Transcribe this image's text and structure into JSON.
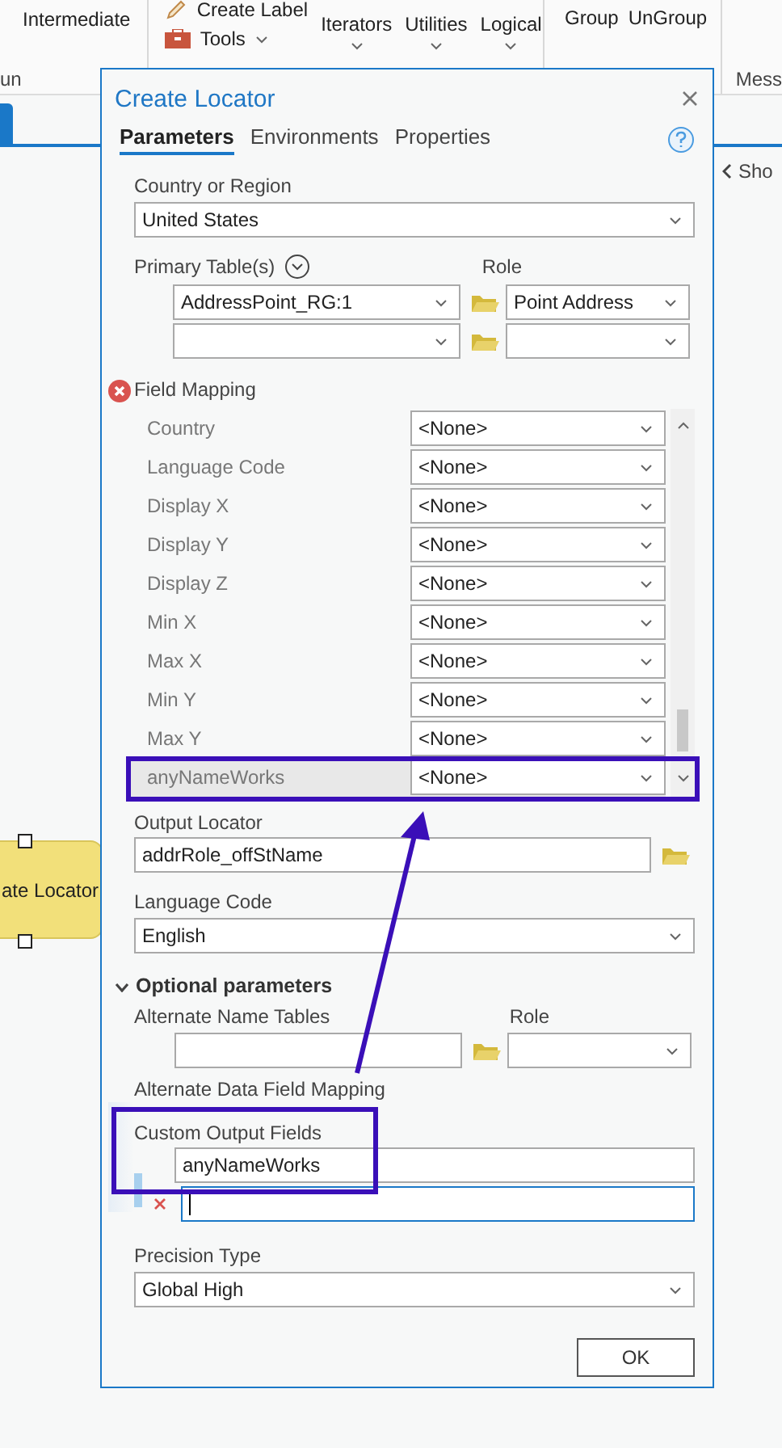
{
  "ribbon": {
    "group_labels": [
      "un",
      "Mess"
    ],
    "intermediate": "Intermediate",
    "create_label": "Create Label",
    "tools": "Tools",
    "menus": [
      "Iterators",
      "Utilities",
      "Logical"
    ],
    "grouping": [
      "Group",
      "UnGroup"
    ]
  },
  "canvas": {
    "node_label": "ate Locator",
    "side_panel": "Sho"
  },
  "dialog": {
    "title": "Create Locator",
    "tabs": [
      {
        "label": "Parameters",
        "selected": true
      },
      {
        "label": "Environments",
        "selected": false
      },
      {
        "label": "Properties",
        "selected": false
      }
    ],
    "country": {
      "label": "Country or Region",
      "value": "United States"
    },
    "primary_tables": {
      "label": "Primary Table(s)",
      "role_label": "Role",
      "rows": [
        {
          "table": "AddressPoint_RG:1",
          "role": "Point Address"
        },
        {}
      ]
    },
    "field_mapping": {
      "label": "Field Mapping",
      "rows": [
        {
          "label": "Country",
          "value": "<None>",
          "selected": false
        },
        {
          "label": "Language Code",
          "value": "<None>",
          "selected": false
        },
        {
          "label": "Display X",
          "value": "<None>",
          "selected": false
        },
        {
          "label": "Display Y",
          "value": "<None>",
          "selected": false
        },
        {
          "label": "Display Z",
          "value": "<None>",
          "selected": false
        },
        {
          "label": "Min X",
          "value": "<None>",
          "selected": false
        },
        {
          "label": "Max X",
          "value": "<None>",
          "selected": false
        },
        {
          "label": "Min Y",
          "value": "<None>",
          "selected": false
        },
        {
          "label": "Max Y",
          "value": "<None>",
          "selected": false
        },
        {
          "label": "anyNameWorks",
          "value": "<None>",
          "selected": true
        }
      ]
    },
    "output_locator": {
      "label": "Output Locator",
      "value": "addrRole_offStName"
    },
    "language_code": {
      "label": "Language Code",
      "value": "English"
    },
    "optional": {
      "label": "Optional parameters",
      "expanded": true
    },
    "alternate_name_tables": {
      "label": "Alternate Name Tables",
      "role_label": "Role"
    },
    "alternate_data_field_mapping": {
      "label": "Alternate Data Field Mapping"
    },
    "custom_output_fields": {
      "label": "Custom Output Fields",
      "values": [
        "anyNameWorks"
      ]
    },
    "precision_type": {
      "label": "Precision Type",
      "value": "Global High"
    },
    "ok": "OK"
  }
}
